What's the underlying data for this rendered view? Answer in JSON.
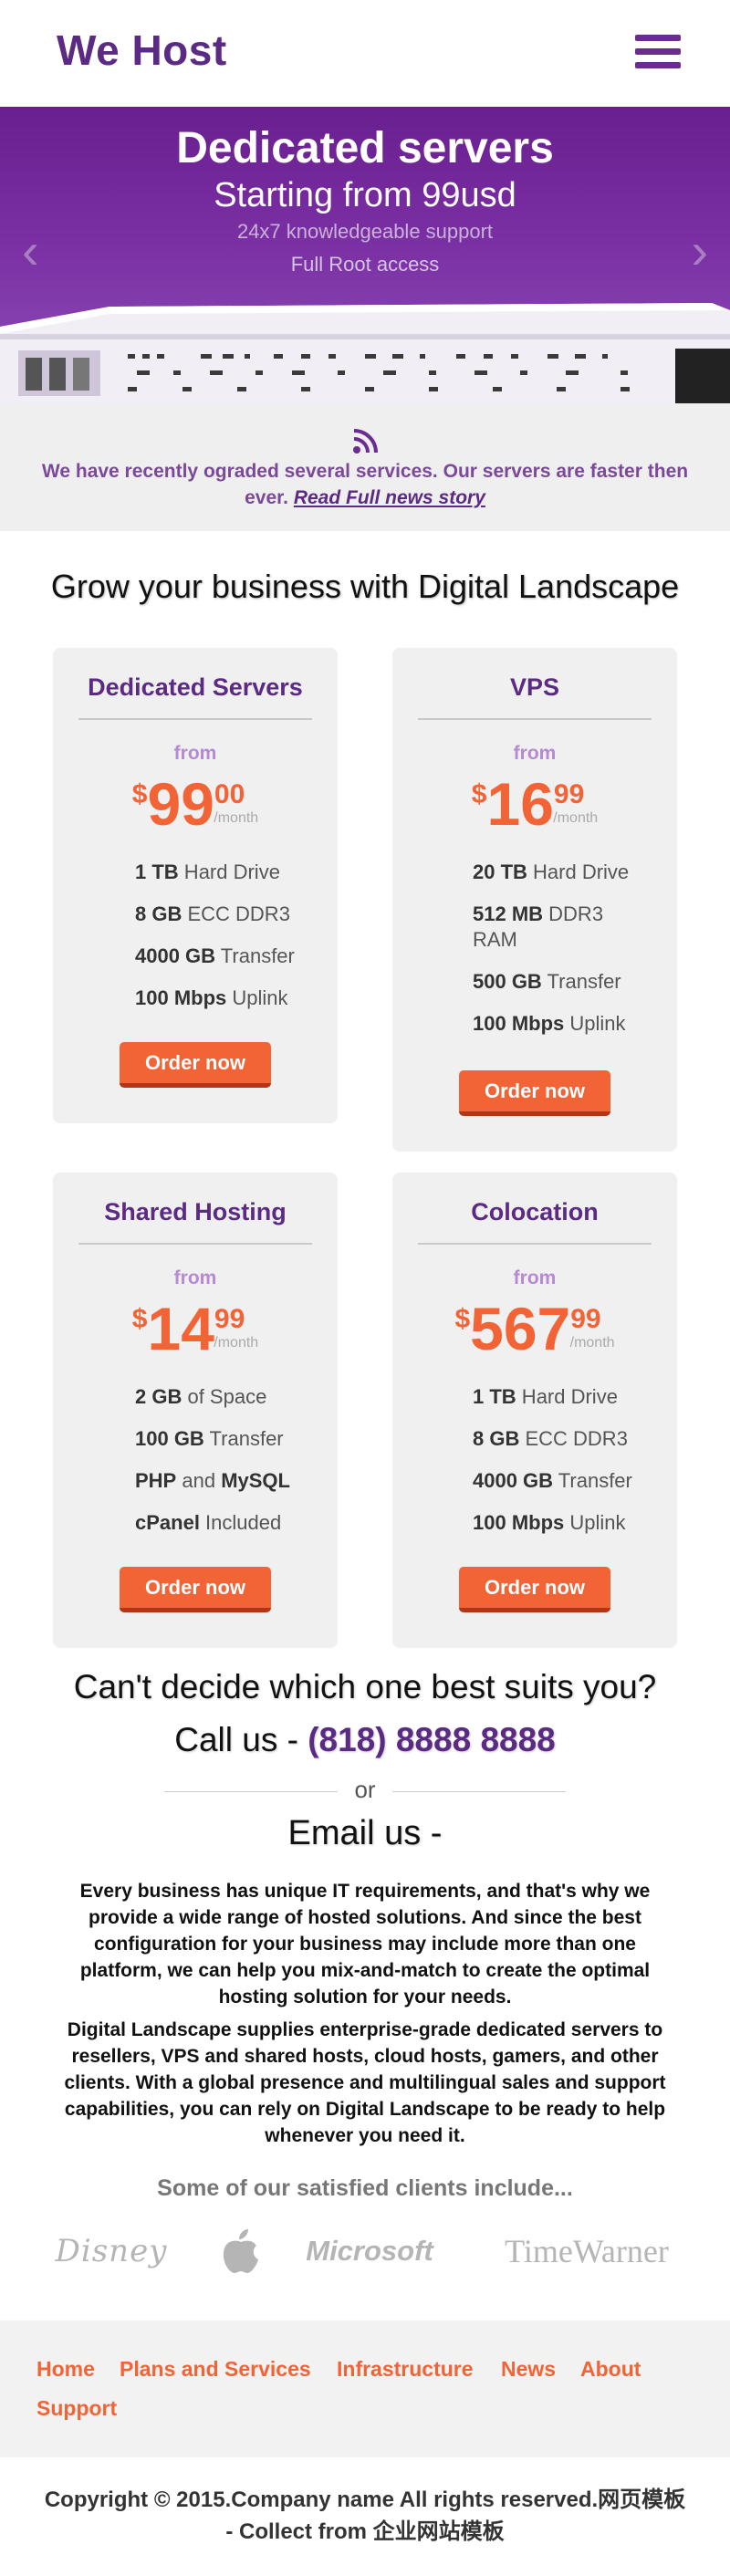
{
  "header": {
    "logo": "We Host",
    "menu_icon": "hamburger-menu-icon"
  },
  "hero": {
    "title": "Dedicated servers",
    "subtitle": "Starting from 99usd",
    "line1": "24x7 knowledgeable support",
    "line2": "Full Root access",
    "prev_icon": "chevron-left-icon",
    "next_icon": "chevron-right-icon"
  },
  "news": {
    "icon": "rss-icon",
    "text": "We have recently ograded several services. Our servers are faster then ever.",
    "link": "Read Full news story"
  },
  "plans_title": "Grow your business with Digital Landscape",
  "plans": [
    {
      "title": "Dedicated Servers",
      "from": "from",
      "currency": "$",
      "price_int": "99",
      "price_dec": "00",
      "period": "/month",
      "features": [
        {
          "bold": "1 TB",
          "rest": " Hard Drive"
        },
        {
          "bold": "8 GB",
          "rest": " ECC DDR3"
        },
        {
          "bold": "4000 GB",
          "rest": " Transfer"
        },
        {
          "bold": "100 Mbps",
          "rest": " Uplink"
        }
      ],
      "button": "Order now"
    },
    {
      "title": "VPS",
      "from": "from",
      "currency": "$",
      "price_int": "16",
      "price_dec": "99",
      "period": "/month",
      "features": [
        {
          "bold": "20 TB",
          "rest": " Hard Drive"
        },
        {
          "bold": "512 MB",
          "rest": " DDR3 RAM"
        },
        {
          "bold": "500 GB",
          "rest": " Transfer"
        },
        {
          "bold": "100 Mbps",
          "rest": " Uplink"
        }
      ],
      "button": "Order now"
    },
    {
      "title": "Shared Hosting",
      "from": "from",
      "currency": "$",
      "price_int": "14",
      "price_dec": "99",
      "period": "/month",
      "features": [
        {
          "bold": "2 GB",
          "rest": " of Space"
        },
        {
          "bold": "100 GB",
          "rest": " Transfer"
        },
        {
          "bold": "PHP",
          "rest": " and ",
          "bold2": "MySQL"
        },
        {
          "bold": "cPanel",
          "rest": " Included"
        }
      ],
      "button": "Order now"
    },
    {
      "title": "Colocation",
      "from": "from",
      "currency": "$",
      "price_int": "567",
      "price_dec": "99",
      "period": "/month",
      "features": [
        {
          "bold": "1 TB",
          "rest": " Hard Drive"
        },
        {
          "bold": "8 GB",
          "rest": " ECC DDR3"
        },
        {
          "bold": "4000 GB",
          "rest": " Transfer"
        },
        {
          "bold": "100 Mbps",
          "rest": " Uplink"
        }
      ],
      "button": "Order now"
    }
  ],
  "contact": {
    "question": "Can't decide which one best suits you?",
    "call_prefix": "Call us - ",
    "phone": "(818) 8888 8888",
    "or": "or",
    "email_line": "Email us -"
  },
  "about": {
    "para1": "Every business has unique IT requirements, and that's why we provide a wide range of hosted solutions. And since the best configuration for your business may include more than one platform, we can help you mix-and-match to create the optimal hosting solution for your needs.",
    "para2": "Digital Landscape supplies enterprise-grade dedicated servers to resellers, VPS and shared hosts, cloud hosts, gamers, and other clients. With a global presence and multilingual sales and support capabilities, you can rely on Digital Landscape to be ready to help whenever you need it."
  },
  "clients": {
    "title": "Some of our satisfied clients include...",
    "logos": [
      "Disney",
      "apple-logo-icon",
      "Microsoft",
      "TimeWarner"
    ]
  },
  "footer_nav": [
    "Home",
    "Plans and Services",
    "Infrastructure",
    "News",
    "About",
    "Support"
  ],
  "copyright": {
    "line1": "Copyright © 2015.Company name All rights reserved.",
    "link1": "网页模板",
    "line2": " - Collect from ",
    "link2": "企业网站模板"
  }
}
